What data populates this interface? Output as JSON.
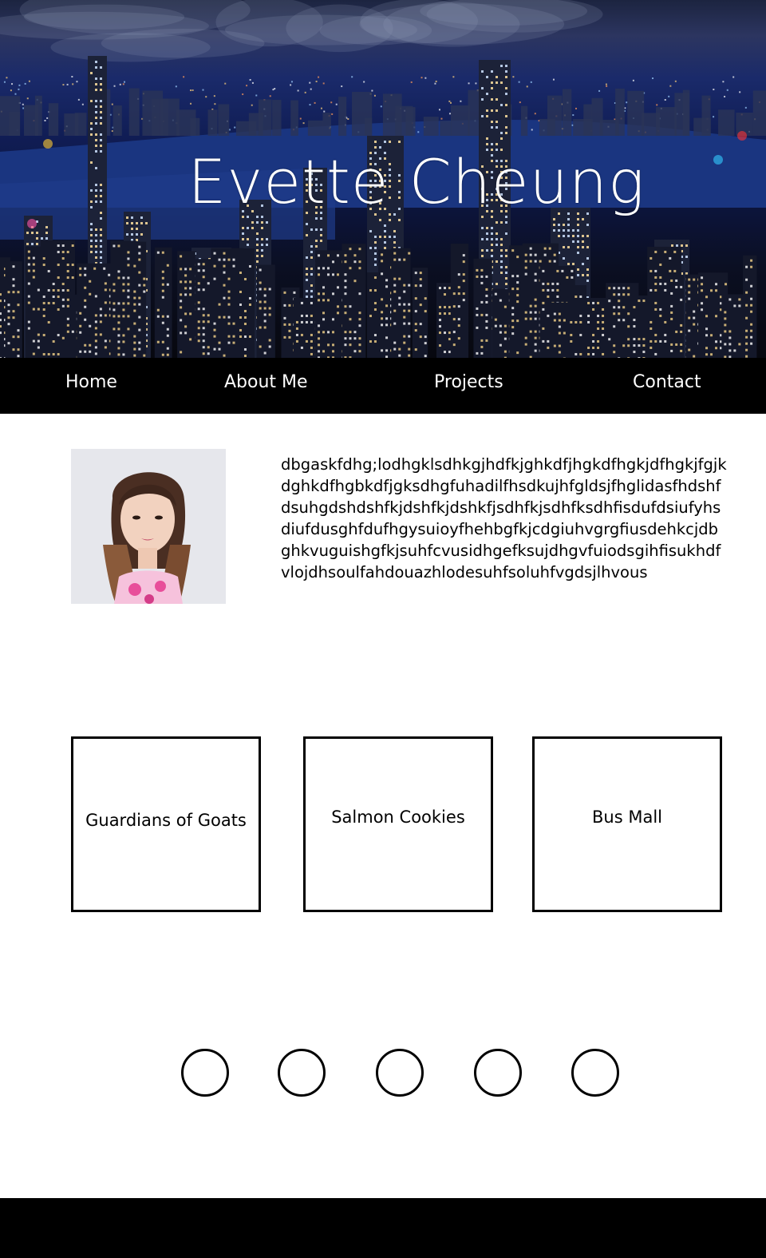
{
  "header": {
    "title": "Evette Cheung",
    "background_image": "night-city-skyline"
  },
  "nav": {
    "items": [
      {
        "label": "Home"
      },
      {
        "label": "About Me"
      },
      {
        "label": "Projects"
      },
      {
        "label": "Contact"
      }
    ]
  },
  "about": {
    "avatar": "profile-photo",
    "bio": "dbgaskfdhg;lodhgklsdhkgjhdfkjghkdfjhgkdfhgkjdfhgkjfgjkdghkdfhgbkdfjgksdhgfuhadilfhsdkujhfgldsjfhglidasfhdshfdsuhgdshdshfkjdshfkjdshkfjsdhfkjsdhfksdhfisdufdsiufyhsdiufdusghfdufhgysuioyfhehbgfkjcdgiuhvgrgfiusdehkcjdbghkvuguishgfkjsuhfcvusidhgefksujdhgvfuiodsgihfisukhdfvlojdhsoulfahdouazhlodesuhfsoluhfvgdsjlhvous"
  },
  "projects": [
    {
      "label": "Guardians of Goats"
    },
    {
      "label": "Salmon Cookies"
    },
    {
      "label": "Bus Mall"
    }
  ],
  "social_circles": [
    {
      "icon": "circle-icon"
    },
    {
      "icon": "circle-icon"
    },
    {
      "icon": "circle-icon"
    },
    {
      "icon": "circle-icon"
    },
    {
      "icon": "circle-icon"
    }
  ],
  "colors": {
    "nav_bg": "#000000",
    "footer_bg": "#000000",
    "text": "#000000",
    "nav_text": "#ffffff"
  }
}
